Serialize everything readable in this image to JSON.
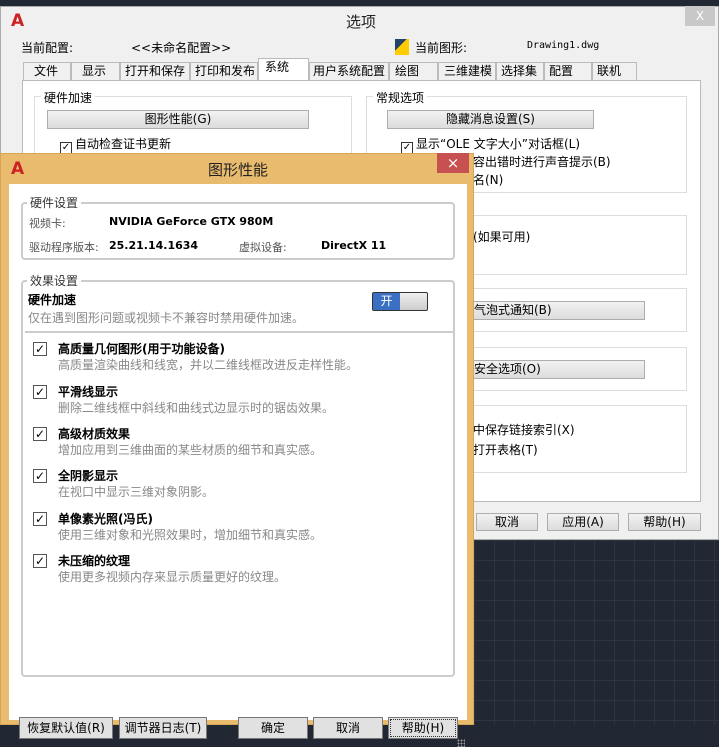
{
  "options": {
    "title": "选项",
    "close": "X",
    "current_profile_label": "当前配置:",
    "current_profile": "<<未命名配置>>",
    "current_drawing_label": "当前图形:",
    "current_drawing": "Drawing1.dwg",
    "tabs": [
      "文件",
      "显示",
      "打开和保存",
      "打印和发布",
      "系统",
      "用户系统配置",
      "绘图",
      "三维建模",
      "选择集",
      "配置",
      "联机"
    ],
    "hw_group": "硬件加速",
    "graphics_perf_button": "图形性能(G)",
    "auto_check_cert": "自动检查证书更新",
    "general_group": "常规选项",
    "hidden_msg_button": "隐藏消息设置(S)",
    "show_ole": "显示“OLE 文字大小”对话框(L)",
    "beep_partial": "容出错时进行声音提示(B)",
    "name_partial": "名(N)",
    "if_available_partial": "(如果可用)",
    "bubble_button_partial": "气泡式通知(B)",
    "security_button_partial": "安全选项(O)",
    "save_link_partial": "中保存链接索引(X)",
    "open_table_partial": "打开表格(T)",
    "cancel": "取消",
    "apply": "应用(A)",
    "help": "帮助(H)"
  },
  "graphics": {
    "title": "图形性能",
    "close": "×",
    "hw_settings": "硬件设置",
    "video_card_label": "视频卡:",
    "video_card": "NVIDIA GeForce GTX 980M",
    "driver_label": "驱动程序版本:",
    "driver": "25.21.14.1634",
    "virtual_device_label": "虚拟设备:",
    "virtual_device": "DirectX 11",
    "effects": "效果设置",
    "hw_accel": "硬件加速",
    "hw_accel_desc": "仅在遇到图形问题或视频卡不兼容时禁用硬件加速。",
    "toggle_on": "开",
    "items": [
      {
        "title": "高质量几何图形(用于功能设备)",
        "desc": "高质量渲染曲线和线宽，并以二维线框改进反走样性能。",
        "checked": true
      },
      {
        "title": "平滑线显示",
        "desc": "删除二维线框中斜线和曲线式边显示时的锯齿效果。",
        "checked": true
      },
      {
        "title": "高级材质效果",
        "desc": "增加应用到三维曲面的某些材质的细节和真实感。",
        "checked": true
      },
      {
        "title": "全阴影显示",
        "desc": "在视口中显示三维对象阴影。",
        "checked": true
      },
      {
        "title": "单像素光照(冯氏)",
        "desc": "使用三维对象和光照效果时，增加细节和真实感。",
        "checked": true
      },
      {
        "title": "未压缩的纹理",
        "desc": "使用更多视频内存来显示质量更好的纹理。",
        "checked": true
      }
    ],
    "restore": "恢复默认值(R)",
    "tuner_log": "调节器日志(T)",
    "ok": "确定",
    "cancel": "取消",
    "help": "帮助(H)"
  },
  "colors": {
    "accent": "#3a6fc4",
    "frame": "#e8bb6e",
    "close_red": "#c75050"
  }
}
